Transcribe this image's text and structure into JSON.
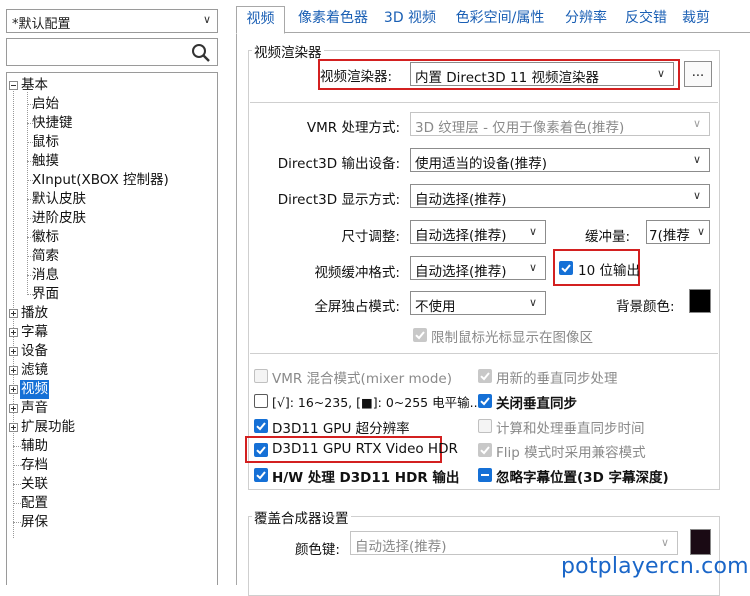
{
  "profile": {
    "selected": "*默认配置"
  },
  "tree": {
    "items": [
      {
        "label": "基本",
        "expanded": true
      },
      {
        "label": "启始"
      },
      {
        "label": "快捷键"
      },
      {
        "label": "鼠标"
      },
      {
        "label": "触摸"
      },
      {
        "label": "XInput(XBOX 控制器)"
      },
      {
        "label": "默认皮肤"
      },
      {
        "label": "进阶皮肤"
      },
      {
        "label": "徽标"
      },
      {
        "label": "简索"
      },
      {
        "label": "消息"
      },
      {
        "label": "界面"
      },
      {
        "label": "播放"
      },
      {
        "label": "字幕"
      },
      {
        "label": "设备"
      },
      {
        "label": "滤镜"
      },
      {
        "label": "视频",
        "selected": true
      },
      {
        "label": "声音"
      },
      {
        "label": "扩展功能"
      },
      {
        "label": "辅助"
      },
      {
        "label": "存档"
      },
      {
        "label": "关联"
      },
      {
        "label": "配置"
      },
      {
        "label": "屏保"
      }
    ]
  },
  "tabs": [
    "视频",
    "像素着色器",
    "3D 视频",
    "色彩空间/属性",
    "分辨率",
    "反交错",
    "裁剪"
  ],
  "renderer": {
    "group_title": "视频渲染器",
    "label": "视频渲染器:",
    "value": "内置 Direct3D 11 视频渲染器",
    "more_button": "..."
  },
  "settings": {
    "vmr_mode": {
      "label": "VMR 处理方式:",
      "value": "3D 纹理层 - 仅用于像素着色(推荐)"
    },
    "d3d_device": {
      "label": "Direct3D 输出设备:",
      "value": "使用适当的设备(推荐)"
    },
    "d3d_display": {
      "label": "Direct3D 显示方式:",
      "value": "自动选择(推荐)"
    },
    "resize": {
      "label": "尺寸调整:",
      "value": "自动选择(推荐)"
    },
    "buffer": {
      "label": "缓冲量:",
      "value": "7(推荐"
    },
    "buffer_format": {
      "label": "视频缓冲格式:",
      "value": "自动选择(推荐)"
    },
    "ten_bit": {
      "label": "10 位输出",
      "checked": true
    },
    "fullscreen": {
      "label": "全屏独占模式:",
      "value": "不使用"
    },
    "bg_color": {
      "label": "背景颜色:",
      "color": "#000000"
    },
    "limit_cursor": {
      "label": "限制鼠标光标显示在图像区"
    }
  },
  "options": {
    "vmr_mix": {
      "label": "VMR 混合模式(mixer mode)"
    },
    "new_vsync": {
      "label": "用新的垂直同步处理"
    },
    "levels": {
      "label": "[√]: 16~235, [■]: 0~255 电平输..."
    },
    "vsync_off": {
      "label": "关闭垂直同步"
    },
    "d3d11_sr": {
      "label": "D3D11 GPU 超分辨率"
    },
    "calc_vsync": {
      "label": "计算和处理垂直同步时间"
    },
    "rtx_hdr": {
      "label": "D3D11 GPU RTX Video HDR"
    },
    "flip_mode": {
      "label": "Flip 模式时采用兼容模式"
    },
    "hw_hdr": {
      "label": "H/W 处理 D3D11 HDR 输出"
    },
    "ignore_sub": {
      "label": "忽略字幕位置(3D 字幕深度)"
    }
  },
  "overlay": {
    "group_title": "覆盖合成器设置",
    "color_key_label": "颜色键:",
    "color_key_value": "自动选择(推荐)",
    "color": "#1a0a14"
  },
  "watermark": "potplayercn.com",
  "colors": {
    "accent": "#1570d6",
    "highlight_red": "#d32020",
    "tab_text": "#1a5fb4"
  }
}
